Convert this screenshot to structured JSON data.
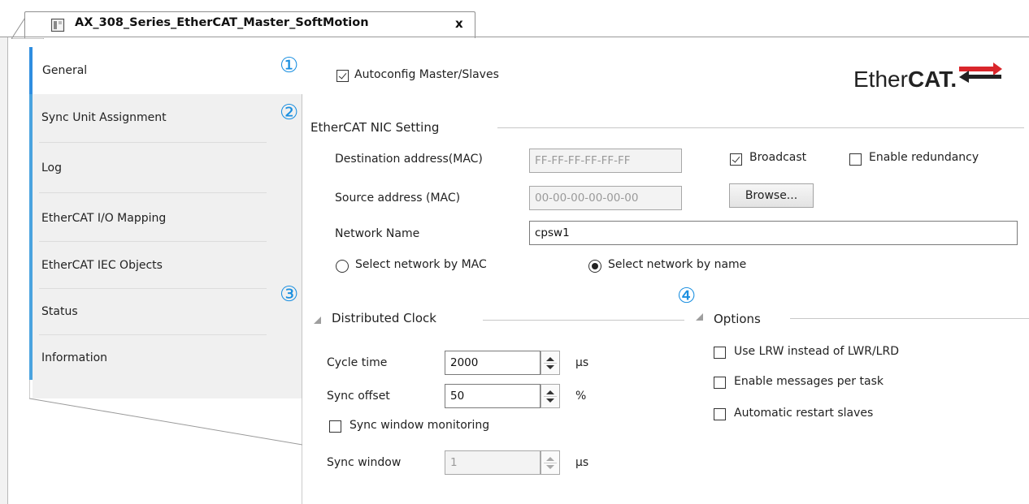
{
  "document_tab": {
    "title": "AX_308_Series_EtherCAT_Master_SoftMotion",
    "close": "x"
  },
  "nav": {
    "items": [
      {
        "label": "General",
        "selected": true
      },
      {
        "label": "Sync Unit Assignment"
      },
      {
        "label": "Log"
      },
      {
        "label": "EtherCAT I/O Mapping"
      },
      {
        "label": "EtherCAT IEC Objects"
      },
      {
        "label": "Status"
      },
      {
        "label": "Information"
      }
    ]
  },
  "markers": [
    "①",
    "②",
    "③",
    "④"
  ],
  "general": {
    "autoconfig_label": "Autoconfig Master/Slaves",
    "autoconfig_checked": true,
    "logo": {
      "prefix": "Ether",
      "bold": "CAT",
      "suffix": "."
    }
  },
  "nic": {
    "title": "EtherCAT NIC Setting",
    "dest_label": "Destination address(MAC)",
    "dest_value": "FF-FF-FF-FF-FF-FF",
    "broadcast_label": "Broadcast",
    "broadcast_checked": true,
    "redundancy_label": "Enable redundancy",
    "redundancy_checked": false,
    "source_label": "Source address (MAC)",
    "source_value": "00-00-00-00-00-00",
    "browse_label": "Browse...",
    "network_name_label": "Network Name",
    "network_name_value": "cpsw1",
    "select_mac_label": "Select network by MAC",
    "select_name_label": "Select network by name",
    "selected_mode": "name"
  },
  "distributed_clock": {
    "title": "Distributed Clock",
    "cycle_time_label": "Cycle time",
    "cycle_time_value": "2000",
    "cycle_time_unit": "µs",
    "sync_offset_label": "Sync offset",
    "sync_offset_value": "50",
    "sync_offset_unit": "%",
    "sync_window_monitoring_label": "Sync window monitoring",
    "sync_window_monitoring_checked": false,
    "sync_window_label": "Sync window",
    "sync_window_value": "1",
    "sync_window_unit": "µs"
  },
  "options": {
    "title": "Options",
    "lrw_label": "Use LRW instead of LWR/LRD",
    "messages_label": "Enable messages per task",
    "restart_label": "Automatic restart slaves"
  },
  "colors": {
    "marker": "#1a8fe0",
    "nav_accent": "#4aa3df",
    "logo_red": "#d9262b"
  }
}
